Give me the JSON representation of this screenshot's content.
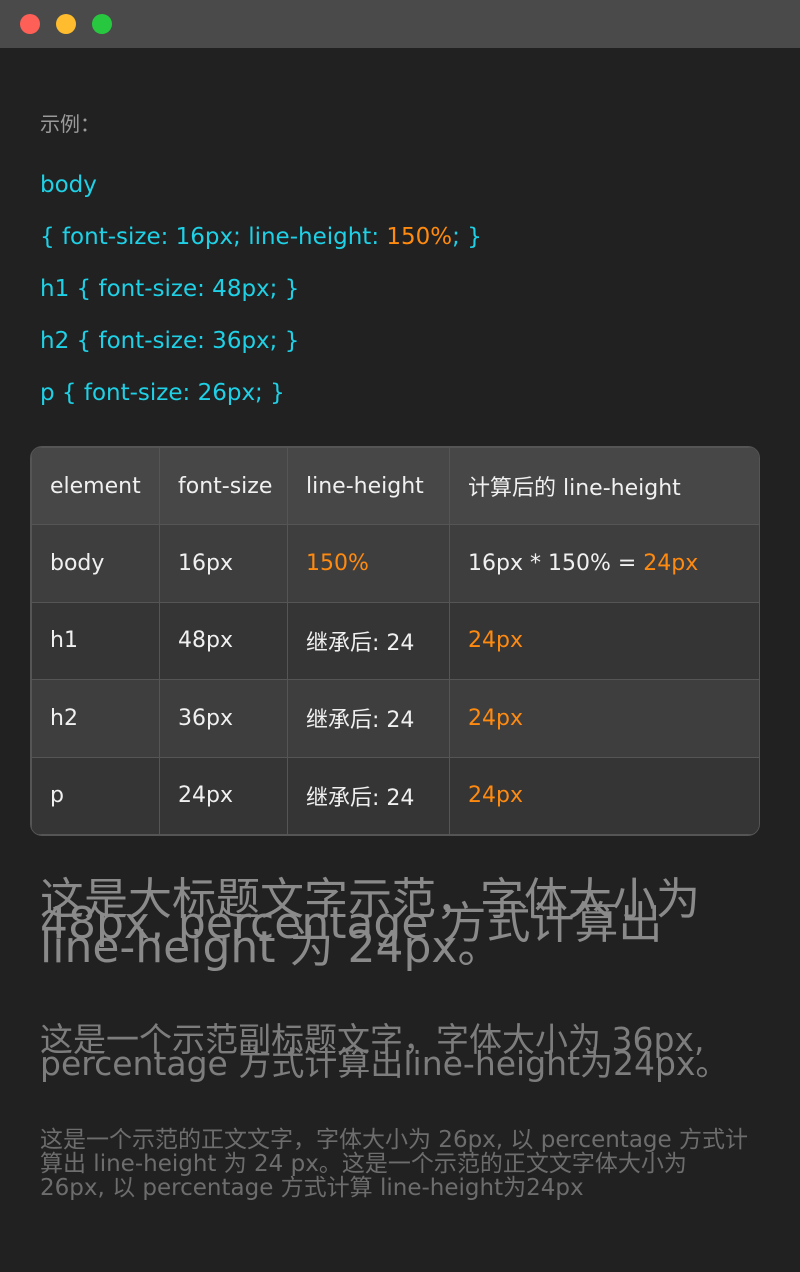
{
  "example_label": "示例：",
  "code": {
    "line1": "body",
    "line2_pre": "{ font-size: 16px; line-height: ",
    "line2_highlight": "150%",
    "line2_post": "; }",
    "line3": "h1 { font-size: 48px; }",
    "line4": "h2 { font-size: 36px; }",
    "line5": "p { font-size: 26px; }"
  },
  "table": {
    "headers": [
      "element",
      "font-size",
      "line-height",
      "计算后的 line-height"
    ],
    "rows": [
      {
        "element": "body",
        "font_size": "16px",
        "line_height": "150%",
        "computed_pre": "16px * 150% = ",
        "computed": "24px"
      },
      {
        "element": "h1",
        "font_size": "48px",
        "line_height": "继承后: 24",
        "computed_pre": "",
        "computed": "24px"
      },
      {
        "element": "h2",
        "font_size": "36px",
        "line_height": "继承后: 24",
        "computed_pre": "",
        "computed": "24px"
      },
      {
        "element": "p",
        "font_size": "24px",
        "line_height": "继承后: 24",
        "computed_pre": "",
        "computed": "24px"
      }
    ]
  },
  "samples": {
    "h1": "这是大标题文字示范，字体大小为 48px, percentage 方式计算出 line-height 为 24px。",
    "h2": "这是一个示范副标题文字，字体大小为 36px, percentage 方式计算出line-height为24px。",
    "p": "这是一个示范的正文文字，字体大小为 26px, 以 percentage 方式计算出 line-height 为 24 px。这是一个示范的正文文字体大小为 26px, 以 percentage 方式计算 line-height为24px"
  },
  "colors": {
    "background": "#212121",
    "titlebar": "#4a4a4a",
    "code": "#1fd1e6",
    "highlight": "#ff8a10"
  }
}
